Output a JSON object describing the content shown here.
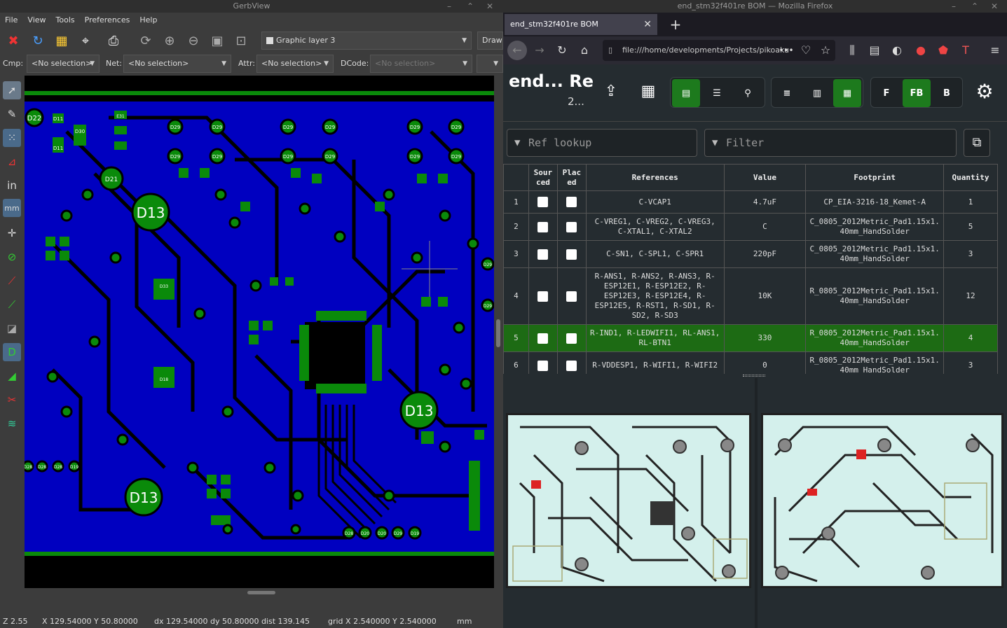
{
  "gerbview": {
    "window_title": "GerbView",
    "menu": [
      "File",
      "View",
      "Tools",
      "Preferences",
      "Help"
    ],
    "layer_combo": "Graphic layer 3",
    "draw_combo": "Draw",
    "cmp_label": "Cmp:",
    "cmp_value": "<No selection>",
    "net_label": "Net:",
    "net_value": "<No selection>",
    "attr_label": "Attr:",
    "attr_value": "<No selection>",
    "dcode_label": "DCode:",
    "dcode_value": "<No selection>",
    "status": {
      "zoom": "Z 2.55",
      "xy": "X 129.54000  Y 50.80000",
      "delta": "dx 129.54000  dy 50.80000  dist 139.145",
      "grid": "grid X 2.540000  Y 2.540000",
      "units": "mm"
    },
    "labels": {
      "d13": "D13",
      "d22": "D22",
      "d21": "D21",
      "d29": "D29",
      "d11": "D11",
      "d30": "D30",
      "e31": "E31",
      "d28": "D28",
      "d20": "D20",
      "d19": "D19",
      "d33": "D33",
      "d18": "D18"
    }
  },
  "firefox": {
    "window_title": "end_stm32f401re BOM — Mozilla Firefox",
    "tab_title": "end_stm32f401re BOM",
    "url": "file:///home/developments/Projects/pikoaku",
    "url_more": "•••",
    "bom": {
      "title": "end... Re",
      "subtitle": "2...",
      "ref_lookup_placeholder": "Ref lookup",
      "filter_placeholder": "Filter",
      "side_buttons": [
        "F",
        "FB",
        "B"
      ],
      "headers": [
        "Sourced",
        "Placed",
        "References",
        "Value",
        "Footprint",
        "Quantity"
      ],
      "header_sourced": "Sour ced",
      "header_placed": "Plac ed",
      "rows": [
        {
          "num": "1",
          "refs": "C-VCAP1",
          "value": "4.7uF",
          "footprint": "CP_EIA-3216-18_Kemet-A",
          "qty": "1"
        },
        {
          "num": "2",
          "refs": "C-VREG1, C-VREG2, C-VREG3, C-XTAL1, C-XTAL2",
          "value": "C",
          "footprint": "C_0805_2012Metric_Pad1.15x1.40mm_HandSolder",
          "qty": "5"
        },
        {
          "num": "3",
          "refs": "C-SN1, C-SPL1, C-SPR1",
          "value": "220pF",
          "footprint": "C_0805_2012Metric_Pad1.15x1.40mm_HandSolder",
          "qty": "3"
        },
        {
          "num": "4",
          "refs": "R-ANS1, R-ANS2, R-ANS3, R-ESP12E1, R-ESP12E2, R-ESP12E3, R-ESP12E4, R-ESP12E5, R-RST1, R-SD1, R-SD2, R-SD3",
          "value": "10K",
          "footprint": "R_0805_2012Metric_Pad1.15x1.40mm_HandSolder",
          "qty": "12"
        },
        {
          "num": "5",
          "refs": "R-IND1, R-LEDWIFI1, RL-ANS1, RL-BTN1",
          "value": "330",
          "footprint": "R_0805_2012Metric_Pad1.15x1.40mm_HandSolder",
          "qty": "4"
        },
        {
          "num": "6",
          "refs": "R-VDDESP1, R-WIFI1, R-WIFI2",
          "value": "0",
          "footprint": "R_0805_2012Metric_Pad1.15x1.40mm_HandSolder",
          "qty": "3"
        }
      ]
    }
  },
  "colors": {
    "pcb_copper": "#0000c0",
    "pcb_pad": "#0a8a0a",
    "highlight_row": "#1d6b14",
    "active_toggle": "#1d7a1d"
  }
}
